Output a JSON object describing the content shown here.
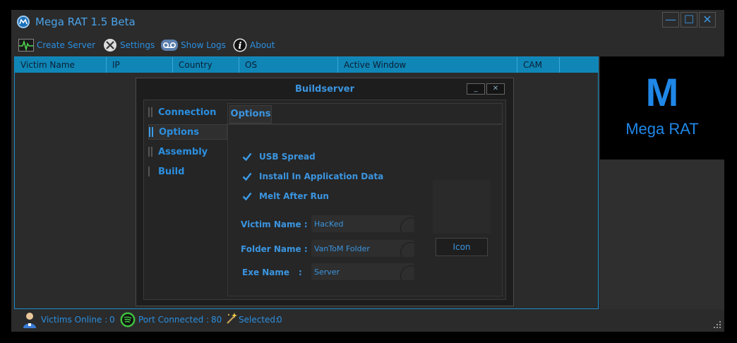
{
  "window": {
    "title": "Mega RAT 1.5 Beta"
  },
  "controls": {
    "minimize": "—",
    "maximize": "☐",
    "close": "✕"
  },
  "menu": {
    "create_server": "Create Server",
    "settings": "Settings",
    "show_logs": "Show Logs",
    "about": "About"
  },
  "grid": {
    "columns": [
      "Victim Name",
      "IP",
      "Country",
      "OS",
      "Active Window",
      "CAM"
    ]
  },
  "logo": {
    "letter": "M",
    "name": "Mega RAT"
  },
  "status": {
    "victims_label": "Victims Online :",
    "victims_value": "0",
    "port_label": "Port Connected :",
    "port_value": "80",
    "selected_label": "Selected:",
    "selected_value": "0"
  },
  "dialog": {
    "title": "Buildserver",
    "min": "_",
    "close": "✕",
    "sidebar": [
      "Connection",
      "Options",
      "Assembly",
      "Build"
    ],
    "active_tab": "Options",
    "options": [
      "USB Spread",
      "Install In Application Data",
      "Melt After Run"
    ],
    "fields": {
      "victim_label": "Victim Name :",
      "victim_value": "HacKed",
      "folder_label": "Folder Name :",
      "folder_value": "VanToM Folder",
      "exe_label": "Exe Name",
      "exe_colon": ":",
      "exe_value": "Server"
    },
    "icon_button": "Icon"
  },
  "colors": {
    "accent": "#2b8fe0",
    "header": "#0f86b6",
    "background": "#2b2b2b"
  }
}
